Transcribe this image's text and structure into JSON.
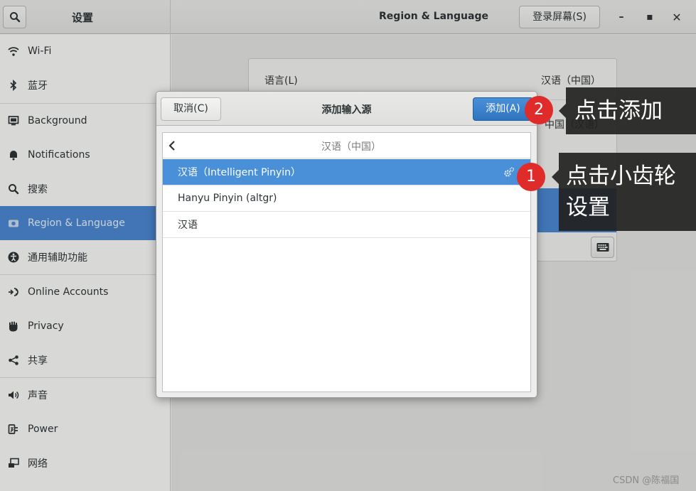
{
  "header": {
    "settings_title": "设置",
    "panel_title": "Region & Language",
    "login_screen_label": "登录屏幕(S)",
    "window_controls": {
      "minimize": "–",
      "maximize": "▪",
      "close": "✕"
    }
  },
  "sidebar": {
    "items": [
      {
        "label": "Wi-Fi",
        "icon": "wifi-icon"
      },
      {
        "label": "蓝牙",
        "icon": "bluetooth-icon"
      },
      {
        "label": "Background",
        "icon": "monitor-icon"
      },
      {
        "label": "Notifications",
        "icon": "bell-icon"
      },
      {
        "label": "搜索",
        "icon": "search-icon"
      },
      {
        "label": "Region & Language",
        "icon": "camera-flag-icon",
        "active": true
      },
      {
        "label": "通用辅助功能",
        "icon": "accessibility-icon"
      },
      {
        "label": "Online Accounts",
        "icon": "online-accounts-icon"
      },
      {
        "label": "Privacy",
        "icon": "hand-icon"
      },
      {
        "label": "共享",
        "icon": "share-icon"
      },
      {
        "label": "声音",
        "icon": "speaker-icon"
      },
      {
        "label": "Power",
        "icon": "power-plug-icon"
      },
      {
        "label": "网络",
        "icon": "network-icon"
      }
    ]
  },
  "main": {
    "language_label": "语言(L)",
    "language_value": "汉语（中国）",
    "formats_value_visible": "中国（汉语）"
  },
  "dialog": {
    "title": "添加输入源",
    "cancel_label": "取消(C)",
    "add_label": "添加(A)",
    "group_title": "汉语（中国）",
    "rows": [
      {
        "label": "汉语（Intelligent Pinyin）",
        "selected": true
      },
      {
        "label": "Hanyu Pinyin (altgr)"
      },
      {
        "label": "汉语"
      }
    ]
  },
  "annotations": {
    "step1": {
      "number": "1",
      "text_line1": "点击小齿轮",
      "text_line2": "设置"
    },
    "step2": {
      "number": "2",
      "text": "点击添加"
    }
  },
  "watermark": "CSDN @陈福国",
  "colors": {
    "accent": "#4a86d0",
    "badge": "#e02b2b",
    "callout": "#222222"
  }
}
